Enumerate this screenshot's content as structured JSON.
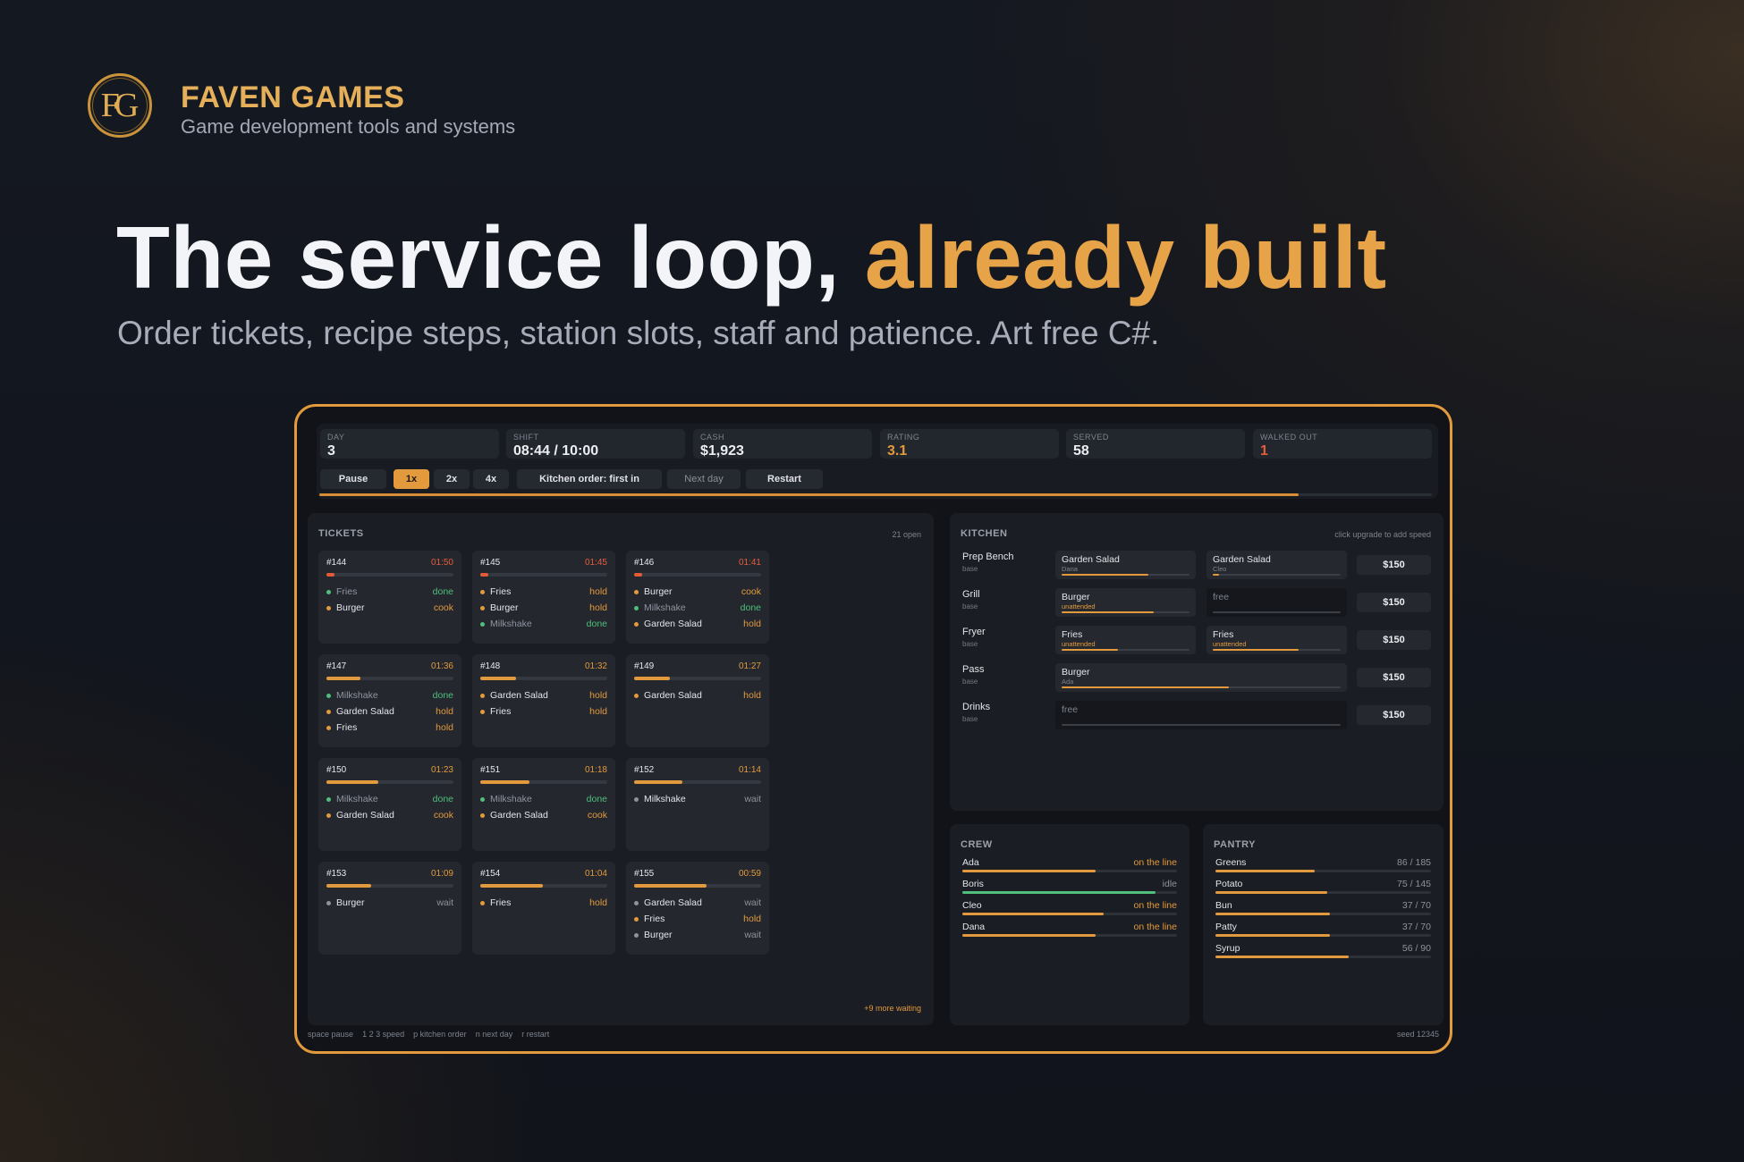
{
  "brand": {
    "logo": "FG",
    "name": "FAVEN GAMES",
    "tagline": "Game development tools and systems"
  },
  "hero": {
    "title_main": "The service loop, ",
    "title_accent": "already built",
    "subtitle": "Order tickets, recipe steps, station slots, staff and patience. Art free C#."
  },
  "colors": {
    "accent": "#e39a3c",
    "done": "#4fbf7b",
    "danger": "#e85c3a",
    "background": "#12151c"
  },
  "stats": [
    {
      "label": "DAY",
      "value": "3"
    },
    {
      "label": "SHIFT",
      "value": "08:44 / 10:00"
    },
    {
      "label": "CASH",
      "value": "$1,923"
    },
    {
      "label": "RATING",
      "value": "3.1"
    },
    {
      "label": "SERVED",
      "value": "58"
    },
    {
      "label": "WALKED OUT",
      "value": "1"
    }
  ],
  "controls": {
    "pause": "Pause",
    "speed_1": "1x",
    "speed_2": "2x",
    "speed_4": "4x",
    "kitchen_order": "Kitchen order: first in",
    "next_day": "Next day",
    "restart": "Restart",
    "active_speed": "1x",
    "day_progress": 0.88
  },
  "tickets_panel": {
    "title": "TICKETS",
    "open_count": "21 open",
    "more_waiting": "+9 more waiting",
    "tickets": [
      {
        "id": "#144",
        "time": "01:50",
        "patience": 0.06,
        "items": [
          {
            "name": "Fries",
            "state": "done"
          },
          {
            "name": "Burger",
            "state": "cook"
          }
        ]
      },
      {
        "id": "#145",
        "time": "01:45",
        "patience": 0.03,
        "items": [
          {
            "name": "Fries",
            "state": "hold"
          },
          {
            "name": "Burger",
            "state": "hold"
          },
          {
            "name": "Milkshake",
            "state": "done"
          }
        ]
      },
      {
        "id": "#146",
        "time": "01:41",
        "patience": 0.02,
        "items": [
          {
            "name": "Burger",
            "state": "cook"
          },
          {
            "name": "Milkshake",
            "state": "done"
          },
          {
            "name": "Garden Salad",
            "state": "hold"
          }
        ]
      },
      {
        "id": "#147",
        "time": "01:36",
        "patience": 0.27,
        "items": [
          {
            "name": "Milkshake",
            "state": "done"
          },
          {
            "name": "Garden Salad",
            "state": "hold"
          },
          {
            "name": "Fries",
            "state": "hold"
          }
        ]
      },
      {
        "id": "#148",
        "time": "01:32",
        "patience": 0.28,
        "items": [
          {
            "name": "Garden Salad",
            "state": "hold"
          },
          {
            "name": "Fries",
            "state": "hold"
          }
        ]
      },
      {
        "id": "#149",
        "time": "01:27",
        "patience": 0.28,
        "items": [
          {
            "name": "Garden Salad",
            "state": "hold"
          }
        ]
      },
      {
        "id": "#150",
        "time": "01:23",
        "patience": 0.41,
        "items": [
          {
            "name": "Milkshake",
            "state": "done"
          },
          {
            "name": "Garden Salad",
            "state": "cook"
          }
        ]
      },
      {
        "id": "#151",
        "time": "01:18",
        "patience": 0.39,
        "items": [
          {
            "name": "Milkshake",
            "state": "done"
          },
          {
            "name": "Garden Salad",
            "state": "cook"
          }
        ]
      },
      {
        "id": "#152",
        "time": "01:14",
        "patience": 0.38,
        "items": [
          {
            "name": "Milkshake",
            "state": "wait"
          }
        ]
      },
      {
        "id": "#153",
        "time": "01:09",
        "patience": 0.35,
        "items": [
          {
            "name": "Burger",
            "state": "wait"
          }
        ]
      },
      {
        "id": "#154",
        "time": "01:04",
        "patience": 0.49,
        "items": [
          {
            "name": "Fries",
            "state": "hold"
          }
        ]
      },
      {
        "id": "#155",
        "time": "00:59",
        "patience": 0.57,
        "items": [
          {
            "name": "Garden Salad",
            "state": "wait"
          },
          {
            "name": "Fries",
            "state": "hold"
          },
          {
            "name": "Burger",
            "state": "wait"
          }
        ]
      }
    ]
  },
  "kitchen_panel": {
    "title": "KITCHEN",
    "note": "click upgrade to add speed",
    "stations": [
      {
        "name": "Prep Bench",
        "level": "base",
        "upgrade": "$150",
        "slots": [
          {
            "item": "Garden Salad",
            "worker": "Dana",
            "progress": 0.68,
            "warn": false
          },
          {
            "item": "Garden Salad",
            "worker": "Cleo",
            "progress": 0.05,
            "warn": false
          }
        ]
      },
      {
        "name": "Grill",
        "level": "base",
        "upgrade": "$150",
        "slots": [
          {
            "item": "Burger",
            "worker": "unattended",
            "progress": 0.72,
            "warn": true
          },
          {
            "item": "free",
            "worker": "",
            "progress": 0,
            "free": true
          }
        ]
      },
      {
        "name": "Fryer",
        "level": "base",
        "upgrade": "$150",
        "slots": [
          {
            "item": "Fries",
            "worker": "unattended",
            "progress": 0.44,
            "warn": true
          },
          {
            "item": "Fries",
            "worker": "unattended",
            "progress": 0.67,
            "warn": true
          }
        ]
      },
      {
        "name": "Pass",
        "level": "base",
        "upgrade": "$150",
        "slots": [
          {
            "item": "Burger",
            "worker": "Ada",
            "progress": 0.6,
            "warn": false,
            "wide": true
          }
        ]
      },
      {
        "name": "Drinks",
        "level": "base",
        "upgrade": "$150",
        "slots": [
          {
            "item": "free",
            "worker": "",
            "progress": 0,
            "free": true,
            "wide": true
          }
        ]
      }
    ]
  },
  "crew_panel": {
    "title": "CREW",
    "members": [
      {
        "name": "Ada",
        "status": "on the line",
        "level": 0.62
      },
      {
        "name": "Boris",
        "status": "idle",
        "level": 0.9
      },
      {
        "name": "Cleo",
        "status": "on the line",
        "level": 0.66
      },
      {
        "name": "Dana",
        "status": "on the line",
        "level": 0.62
      }
    ]
  },
  "pantry_panel": {
    "title": "PANTRY",
    "items": [
      {
        "name": "Greens",
        "amount": "86 / 185",
        "level": 0.46
      },
      {
        "name": "Potato",
        "amount": "75 / 145",
        "level": 0.52
      },
      {
        "name": "Bun",
        "amount": "37 / 70",
        "level": 0.53
      },
      {
        "name": "Patty",
        "amount": "37 / 70",
        "level": 0.53
      },
      {
        "name": "Syrup",
        "amount": "56 / 90",
        "level": 0.62
      }
    ]
  },
  "footer": {
    "hints": [
      "space pause",
      "1 2 3 speed",
      "p kitchen order",
      "n next day",
      "r restart"
    ],
    "seed": "seed 12345"
  }
}
